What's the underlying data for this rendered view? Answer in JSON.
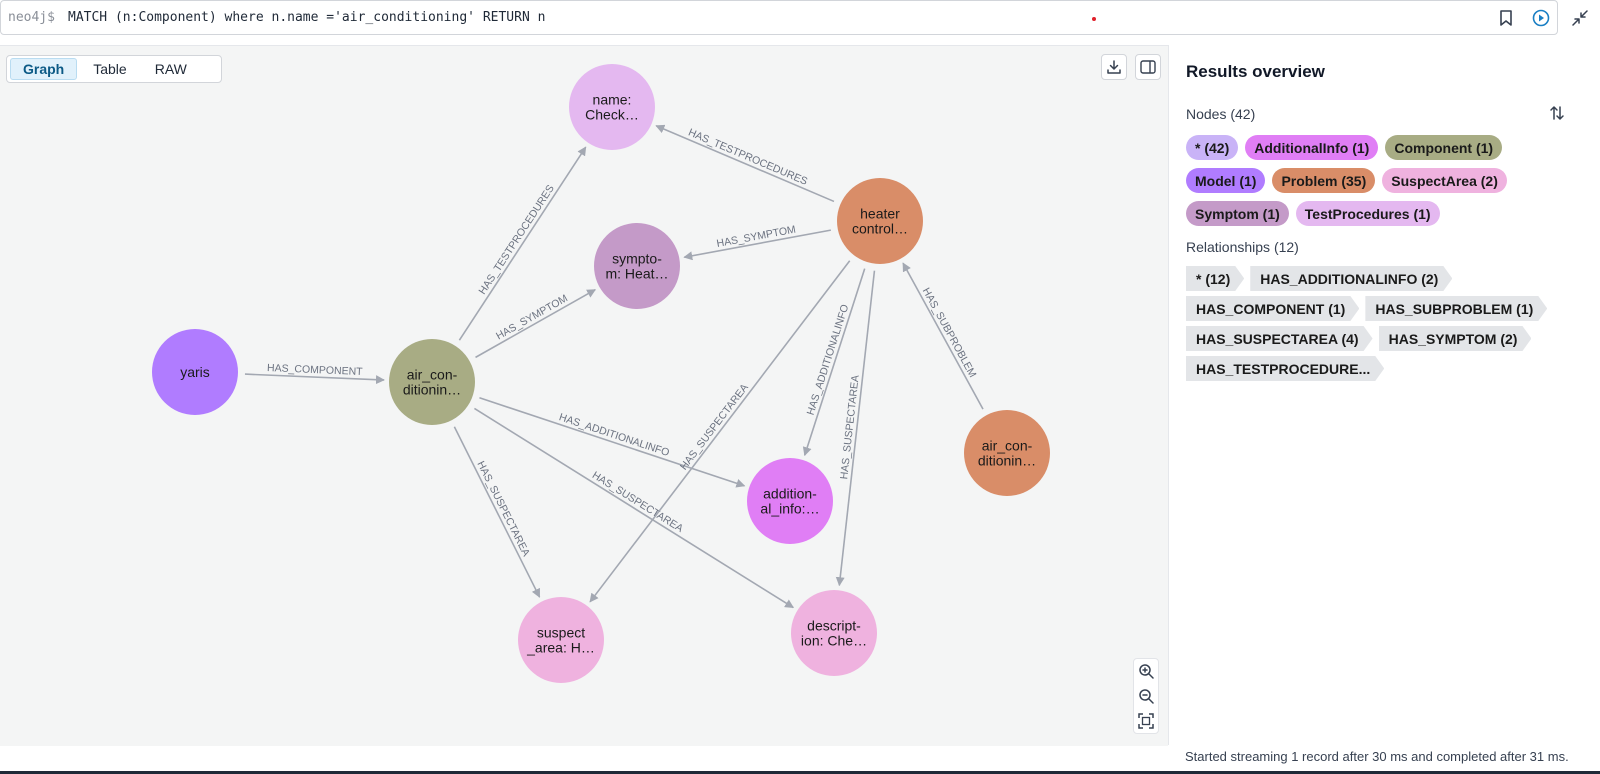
{
  "query_bar": {
    "prompt": "neo4j$",
    "query": "MATCH (n:Component) where n.name ='air_conditioning' RETURN n"
  },
  "view_tabs": [
    "Graph",
    "Table",
    "RAW"
  ],
  "active_view": "Graph",
  "graph": {
    "nodes": [
      {
        "id": "yaris",
        "lines": [
          "yaris"
        ],
        "color": "#b07cff"
      },
      {
        "id": "air_cond_main",
        "lines": [
          "air_con-",
          "ditionin…"
        ],
        "color": "#a8ac84"
      },
      {
        "id": "name_check",
        "lines": [
          "name:",
          "Check…"
        ],
        "color": "#e4b8f0"
      },
      {
        "id": "symptom",
        "lines": [
          "sympto-",
          "m: Heat…"
        ],
        "color": "#c49ac8"
      },
      {
        "id": "heater",
        "lines": [
          "heater",
          "control…"
        ],
        "color": "#d98d68"
      },
      {
        "id": "air_cond_problem",
        "lines": [
          "air_con-",
          "ditionin…"
        ],
        "color": "#d98d68"
      },
      {
        "id": "additional_info",
        "lines": [
          "addition-",
          "al_info:…"
        ],
        "color": "#e07ef5"
      },
      {
        "id": "suspect_area",
        "lines": [
          "suspect",
          "_area: H…"
        ],
        "color": "#efb2df"
      },
      {
        "id": "description",
        "lines": [
          "descript-",
          "ion: Che…"
        ],
        "color": "#efb2df"
      }
    ],
    "edges": [
      {
        "from": "yaris",
        "to": "air_cond_main",
        "label": "HAS_COMPONENT"
      },
      {
        "from": "air_cond_main",
        "to": "name_check",
        "label": "HAS_TESTPROCEDURES"
      },
      {
        "from": "air_cond_main",
        "to": "symptom",
        "label": "HAS_SYMPTOM"
      },
      {
        "from": "air_cond_main",
        "to": "additional_info",
        "label": "HAS_ADDITIONALINFO"
      },
      {
        "from": "air_cond_main",
        "to": "suspect_area",
        "label": "HAS_SUSPECTAREA"
      },
      {
        "from": "air_cond_main",
        "to": "description",
        "label": "HAS_SUSPECTAREA"
      },
      {
        "from": "heater",
        "to": "name_check",
        "label": "HAS_TESTPROCEDURES"
      },
      {
        "from": "heater",
        "to": "symptom",
        "label": "HAS_SYMPTOM"
      },
      {
        "from": "heater",
        "to": "suspect_area",
        "label": "HAS_SUSPECTAREA"
      },
      {
        "from": "heater",
        "to": "additional_info",
        "label": "HAS_ADDITIONALINFO"
      },
      {
        "from": "heater",
        "to": "description",
        "label": "HAS_SUSPECTAREA"
      },
      {
        "from": "air_cond_problem",
        "to": "heater",
        "label": "HAS_SUBPROBLEM"
      }
    ]
  },
  "panel": {
    "title": "Results overview",
    "nodes_label": "Nodes (42)",
    "node_chips": [
      {
        "label": "* (42)",
        "color": "#c9b3f7"
      },
      {
        "label": "AdditionalInfo (1)",
        "color": "#e07ef5"
      },
      {
        "label": "Component (1)",
        "color": "#a8ac84"
      },
      {
        "label": "Model (1)",
        "color": "#b07cff"
      },
      {
        "label": "Problem (35)",
        "color": "#d98d68"
      },
      {
        "label": "SuspectArea (2)",
        "color": "#efb2df"
      },
      {
        "label": "Symptom (1)",
        "color": "#c49ac8"
      },
      {
        "label": "TestProcedures (1)",
        "color": "#e4b8f0"
      }
    ],
    "relationships_label": "Relationships (12)",
    "rel_chips": [
      "* (12)",
      "HAS_ADDITIONALINFO (2)",
      "HAS_COMPONENT (1)",
      "HAS_SUBPROBLEM (1)",
      "HAS_SUSPECTAREA (4)",
      "HAS_SYMPTOM (2)",
      "HAS_TESTPROCEDURE..."
    ]
  },
  "status": "Started streaming 1 record after 30 ms and completed after 31 ms."
}
